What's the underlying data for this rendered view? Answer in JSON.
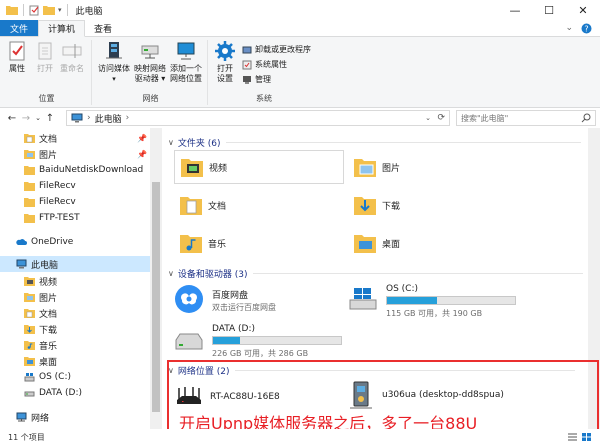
{
  "window": {
    "title": "此电脑",
    "controls": {
      "minimize": "—",
      "maximize": "☐",
      "close": "✕"
    }
  },
  "ribbon_tabs": [
    {
      "label": "文件"
    },
    {
      "label": "计算机"
    },
    {
      "label": "查看"
    }
  ],
  "ribbon": {
    "location": {
      "properties": "属性",
      "open": "打开",
      "rename": "重命名",
      "group": "位置"
    },
    "network": {
      "access_media": "访问媒体",
      "map_drive_1": "映射网络",
      "map_drive_2": "驱动器",
      "add_location_1": "添加一个",
      "add_location_2": "网络位置",
      "group": "网络"
    },
    "system": {
      "open_settings_1": "打开",
      "open_settings_2": "设置",
      "uninstall": "卸载或更改程序",
      "system_properties": "系统属性",
      "manage": "管理",
      "group": "系统"
    }
  },
  "address": {
    "path": "此电脑",
    "search_placeholder": "搜索\"此电脑\""
  },
  "nav": {
    "quick": [
      {
        "label": "文档",
        "pinned": true
      },
      {
        "label": "图片",
        "pinned": true
      },
      {
        "label": "BaiduNetdiskDownload",
        "pinned": false
      },
      {
        "label": "FileRecv",
        "pinned": false
      },
      {
        "label": "FileRecv",
        "pinned": false
      },
      {
        "label": "FTP-TEST",
        "pinned": false
      }
    ],
    "onedrive": "OneDrive",
    "thispc": "此电脑",
    "pc_children": [
      "视频",
      "图片",
      "文档",
      "下载",
      "音乐",
      "桌面",
      "OS (C:)",
      "DATA (D:)"
    ],
    "network": "网络"
  },
  "sections": {
    "folders": "文件夹 (6)",
    "devices": "设备和驱动器 (3)",
    "network": "网络位置 (2)"
  },
  "folders": [
    {
      "name": "视频"
    },
    {
      "name": "图片"
    },
    {
      "name": "文档"
    },
    {
      "name": "下载"
    },
    {
      "name": "音乐"
    },
    {
      "name": "桌面"
    }
  ],
  "drives": [
    {
      "name": "百度网盘",
      "info": "双击运行百度网盘"
    },
    {
      "name": "OS (C:)",
      "info": "115 GB 可用，共 190 GB",
      "used_fraction": 0.39
    },
    {
      "name": "DATA (D:)",
      "info": "226 GB 可用，共 286 GB",
      "used_fraction": 0.21
    }
  ],
  "network_locations": [
    {
      "name": "RT-AC88U-16E8"
    },
    {
      "name": "u306ua (desktop-dd8spua)"
    }
  ],
  "annotation": "开启Upnp媒体服务器之后，多了一台88U",
  "status": {
    "count": "11 个项目"
  },
  "colors": {
    "accent": "#1979ca",
    "selection": "#cce8ff",
    "drive_bar": "#26a0da",
    "annotation": "#e81f25"
  }
}
